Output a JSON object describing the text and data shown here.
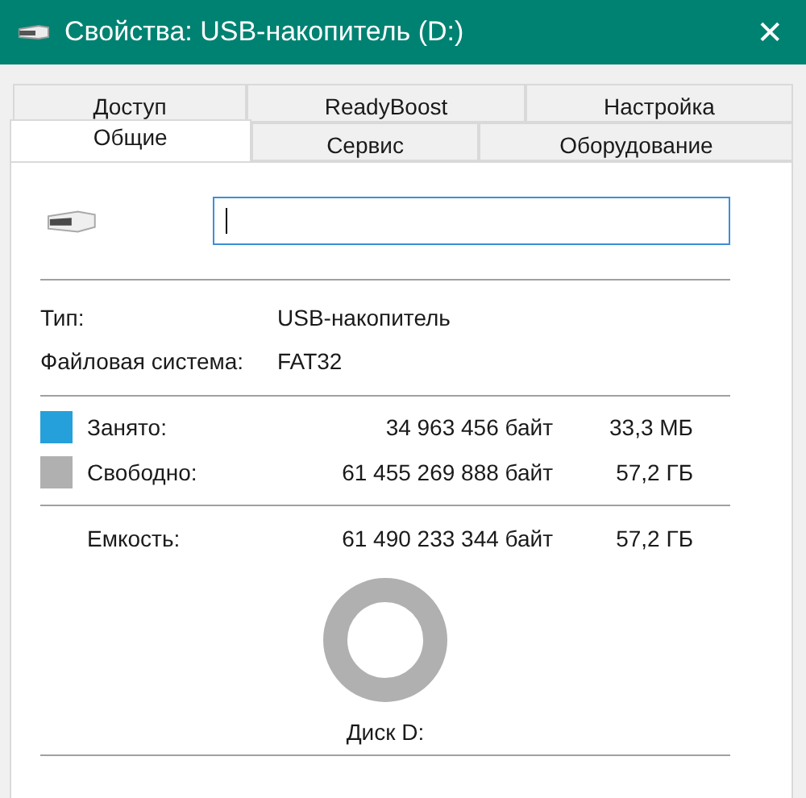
{
  "window": {
    "title": "Свойства: USB-накопитель (D:)",
    "close": "✕"
  },
  "tab_rows": [
    [
      {
        "label": "Доступ",
        "selected": false
      },
      {
        "label": "ReadyBoost",
        "selected": false
      },
      {
        "label": "Настройка",
        "selected": false
      }
    ],
    [
      {
        "label": "Общие",
        "selected": true
      },
      {
        "label": "Сервис",
        "selected": false
      },
      {
        "label": "Оборудование",
        "selected": false
      }
    ]
  ],
  "info": [
    {
      "label": "Тип:",
      "value": "USB-накопитель"
    },
    {
      "label": "Файловая система:",
      "value": "FAT32"
    }
  ],
  "usage": [
    {
      "label": "Занято:",
      "bytes": "34 963 456 байт",
      "size": "33,3 МБ",
      "color": "#26a0da"
    },
    {
      "label": "Свободно:",
      "bytes": "61 455 269 888 байт",
      "size": "57,2 ГБ",
      "color": "#b0b0b0"
    }
  ],
  "capacity": {
    "label": "Емкость:",
    "bytes": "61 490 233 344 байт",
    "size": "57,2 ГБ"
  },
  "disk_label": "Диск D:"
}
